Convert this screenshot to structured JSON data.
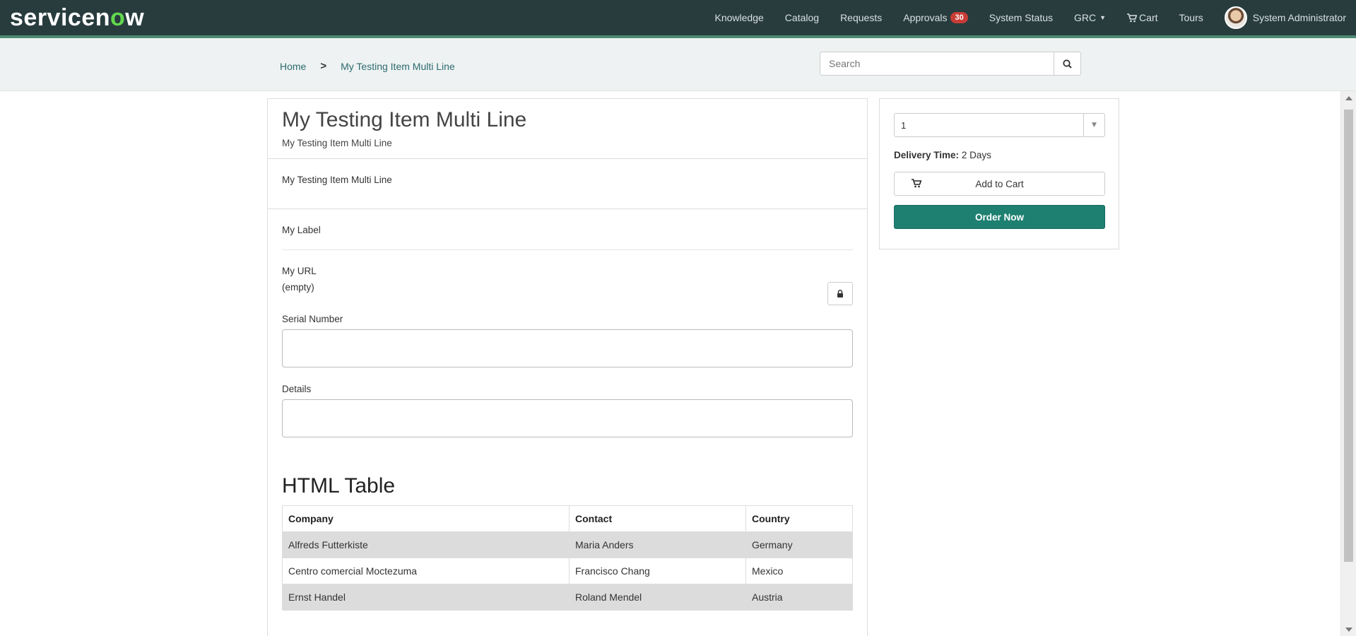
{
  "brand": {
    "logo_text_pre": "servicen",
    "logo_text_o": "o",
    "logo_text_post": "w"
  },
  "nav": {
    "knowledge": "Knowledge",
    "catalog": "Catalog",
    "requests": "Requests",
    "approvals": "Approvals",
    "approvals_count": "30",
    "system_status": "System Status",
    "grc": "GRC",
    "cart": "Cart",
    "tours": "Tours",
    "user": "System Administrator"
  },
  "breadcrumb": {
    "home": "Home",
    "current": "My Testing Item Multi Line"
  },
  "search": {
    "placeholder": "Search"
  },
  "item": {
    "title": "My Testing Item Multi Line",
    "short_description": "My Testing Item Multi Line",
    "description": "My Testing Item Multi Line"
  },
  "form": {
    "my_label": "My Label",
    "my_url_label": "My URL",
    "my_url_value": "(empty)",
    "serial_number_label": "Serial Number",
    "details_label": "Details",
    "html_table_title": "HTML Table"
  },
  "table": {
    "headers": [
      "Company",
      "Contact",
      "Country"
    ],
    "rows": [
      [
        "Alfreds Futterkiste",
        "Maria Anders",
        "Germany"
      ],
      [
        "Centro comercial Moctezuma",
        "Francisco Chang",
        "Mexico"
      ],
      [
        "Ernst Handel",
        "Roland Mendel",
        "Austria"
      ]
    ]
  },
  "order": {
    "quantity": "1",
    "delivery_label": "Delivery Time:",
    "delivery_value": "2 Days",
    "add_to_cart": "Add to Cart",
    "order_now": "Order Now"
  },
  "colors": {
    "nav_bg": "#283c3e",
    "accent": "#1e8071",
    "badge": "#c83c36"
  }
}
